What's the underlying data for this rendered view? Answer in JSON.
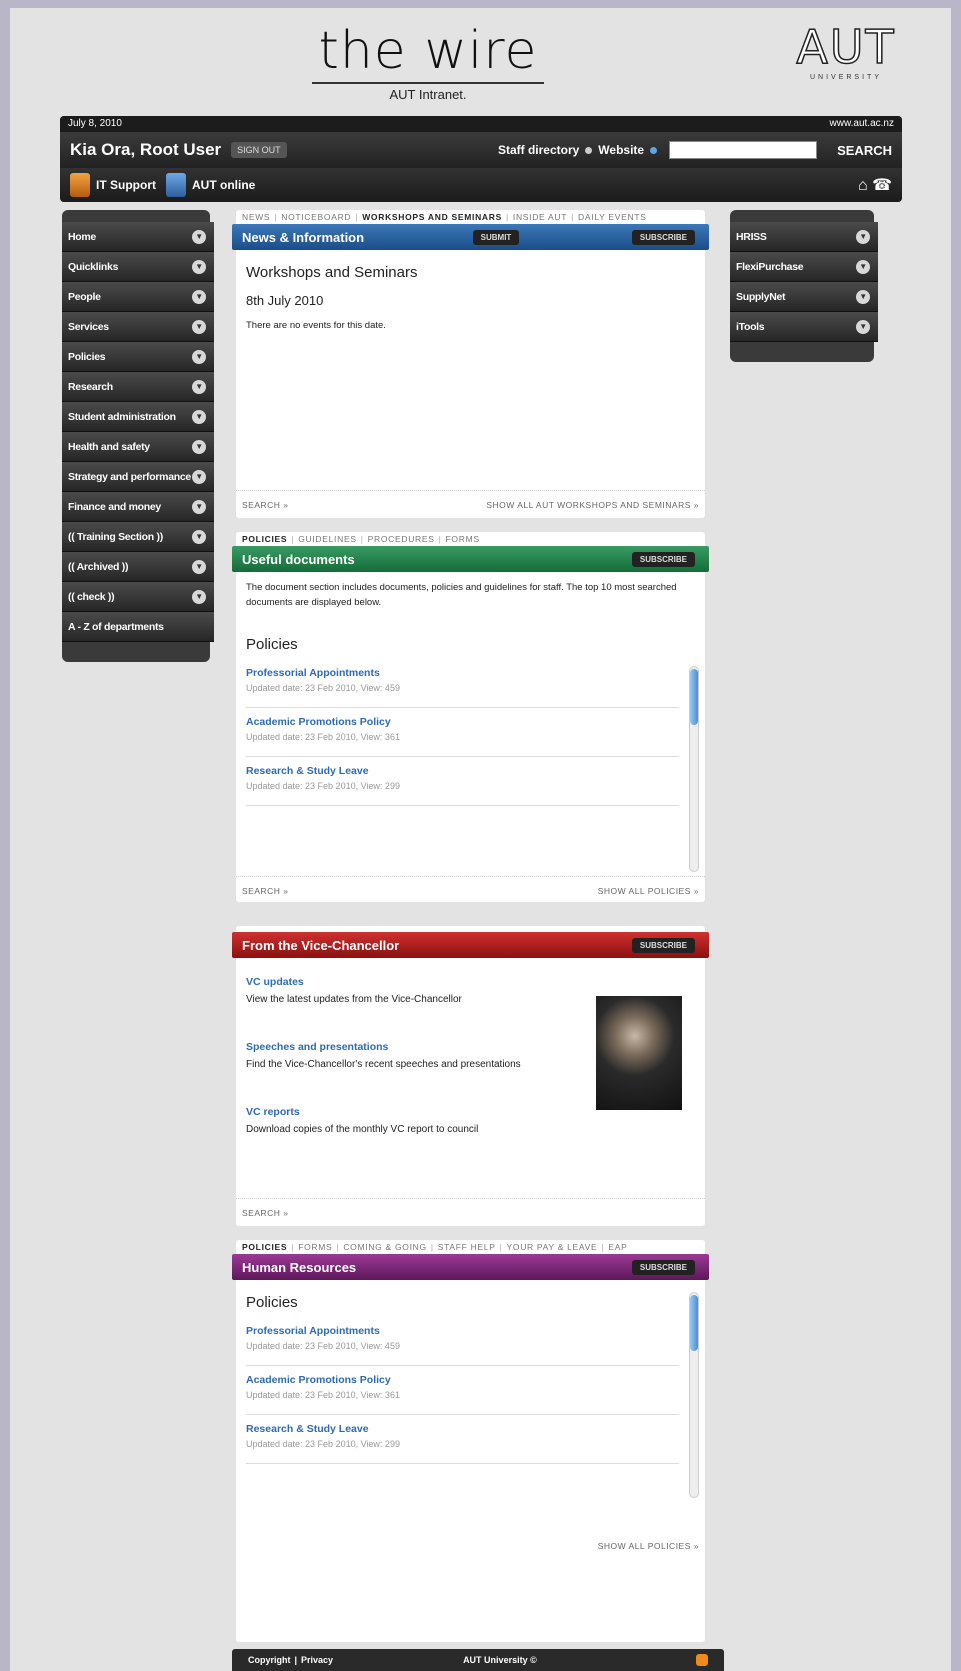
{
  "header": {
    "logo_text": "the wire",
    "subtitle": "AUT Intranet.",
    "aut_logo": "AUT",
    "aut_sub": "UNIVERSITY"
  },
  "topbar": {
    "date": "July 8, 2010",
    "site": "www.aut.ac.nz",
    "greeting": "Kia Ora, Root User",
    "signout": "SIGN OUT",
    "staff_directory": "Staff directory",
    "website": "Website",
    "search_label": "SEARCH",
    "it_support": "IT Support",
    "aut_online": "AUT online",
    "home_icon": "home-icon",
    "phone_icon": "phone-icon"
  },
  "left_menu": [
    "Home",
    "Quicklinks",
    "People",
    "Services",
    "Policies",
    "Research",
    "Student administration",
    "Health and safety",
    "Strategy and performance",
    "Finance and money",
    "(( Training Section ))",
    "(( Archived ))",
    "(( check ))",
    "A - Z of departments"
  ],
  "right_menu": [
    "HRISS",
    "FlexiPurchase",
    "SupplyNet",
    "iTools"
  ],
  "news": {
    "tabs": [
      "NEWS",
      "NOTICEBOARD",
      "WORKSHOPS AND SEMINARS",
      "INSIDE AUT",
      "DAILY EVENTS"
    ],
    "title": "News & Information",
    "submit": "SUBMIT",
    "subscribe": "SUBSCRIBE",
    "heading": "Workshops and Seminars",
    "date": "8th July 2010",
    "text": "There are no events for this date.",
    "search": "SEARCH »",
    "show_all": "SHOW ALL AUT WORKSHOPS AND SEMINARS »"
  },
  "useful": {
    "tabs": [
      "POLICIES",
      "GUIDELINES",
      "PROCEDURES",
      "FORMS"
    ],
    "title": "Useful documents",
    "subscribe": "SUBSCRIBE",
    "intro": "The document section includes documents, policies and guidelines for staff. The top 10 most searched documents are displayed below.",
    "heading": "Policies",
    "docs": [
      {
        "title": "Professorial Appointments",
        "meta": "Updated date: 23 Feb 2010, View: 459"
      },
      {
        "title": "Academic Promotions Policy",
        "meta": "Updated date: 23 Feb 2010, View: 361"
      },
      {
        "title": "Research & Study Leave",
        "meta": "Updated date: 23 Feb 2010, View: 299"
      }
    ],
    "search": "SEARCH »",
    "show_all": "SHOW ALL POLICIES »"
  },
  "vc": {
    "title": "From the Vice-Chancellor",
    "subscribe": "SUBSCRIBE",
    "items": [
      {
        "title": "VC updates",
        "desc": "View the latest updates from the Vice-Chancellor"
      },
      {
        "title": "Speeches and presentations",
        "desc": "Find the Vice-Chancellor's recent speeches and presentations"
      },
      {
        "title": "VC reports",
        "desc": "Download copies of the monthly VC report to council"
      }
    ],
    "search": "SEARCH »"
  },
  "hr": {
    "tabs": [
      "POLICIES",
      "FORMS",
      "COMING & GOING",
      "STAFF HELP",
      "YOUR PAY & LEAVE",
      "EAP"
    ],
    "title": "Human Resources",
    "subscribe": "SUBSCRIBE",
    "heading": "Policies",
    "docs": [
      {
        "title": "Professorial Appointments",
        "meta": "Updated date: 23 Feb 2010, View: 459"
      },
      {
        "title": "Academic Promotions Policy",
        "meta": "Updated date: 23 Feb 2010, View: 361"
      },
      {
        "title": "Research & Study Leave",
        "meta": "Updated date: 23 Feb 2010, View: 299"
      }
    ],
    "show_all": "SHOW ALL POLICIES »"
  },
  "footer": {
    "copyright": "Copyright",
    "privacy": "Privacy",
    "aut": "AUT University ©"
  }
}
